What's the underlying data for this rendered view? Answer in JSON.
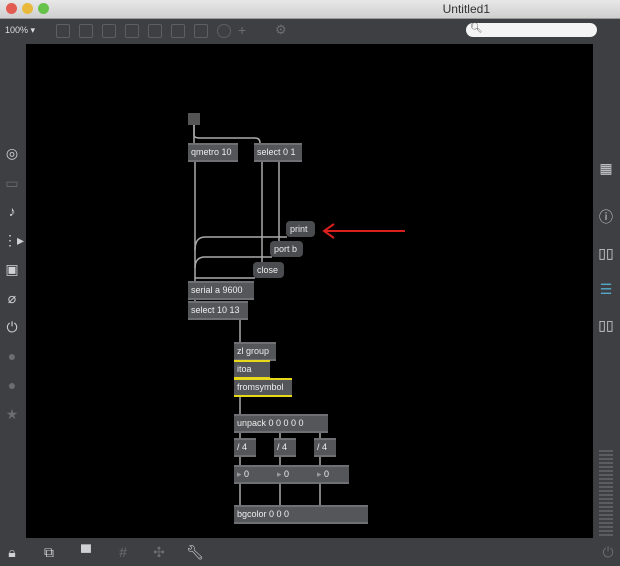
{
  "window": {
    "title": "Untitled1"
  },
  "toolbar": {
    "zoom": "100%",
    "search_placeholder": ""
  },
  "objects": {
    "qmetro": "qmetro 10",
    "select01": "select 0 1",
    "print": "print",
    "port": "port b",
    "close": "close",
    "serial": "serial a 9600",
    "select1013": "select 10 13",
    "zl": "zl group",
    "itoa": "itoa",
    "fromsymbol": "fromsymbol",
    "unpack": "unpack 0 0 0 0 0",
    "div": [
      "/ 4",
      "/ 4",
      "/ 4"
    ],
    "numbers": [
      "0",
      "0",
      "0"
    ],
    "bgcolor": "bgcolor 0 0 0"
  },
  "annotation": {
    "arrow_color": "#d9201f"
  },
  "left_sidebar": [
    "target-icon",
    "bar-icon",
    "music-note-icon",
    "media-icon",
    "image-icon",
    "paperclip-icon",
    "plug-icon",
    "info-circle-icon",
    "b-circle-icon",
    "star-icon"
  ],
  "right_sidebar": [
    "grid-icon",
    "info-icon",
    "book-icon",
    "list-icon",
    "reference-book-icon"
  ]
}
